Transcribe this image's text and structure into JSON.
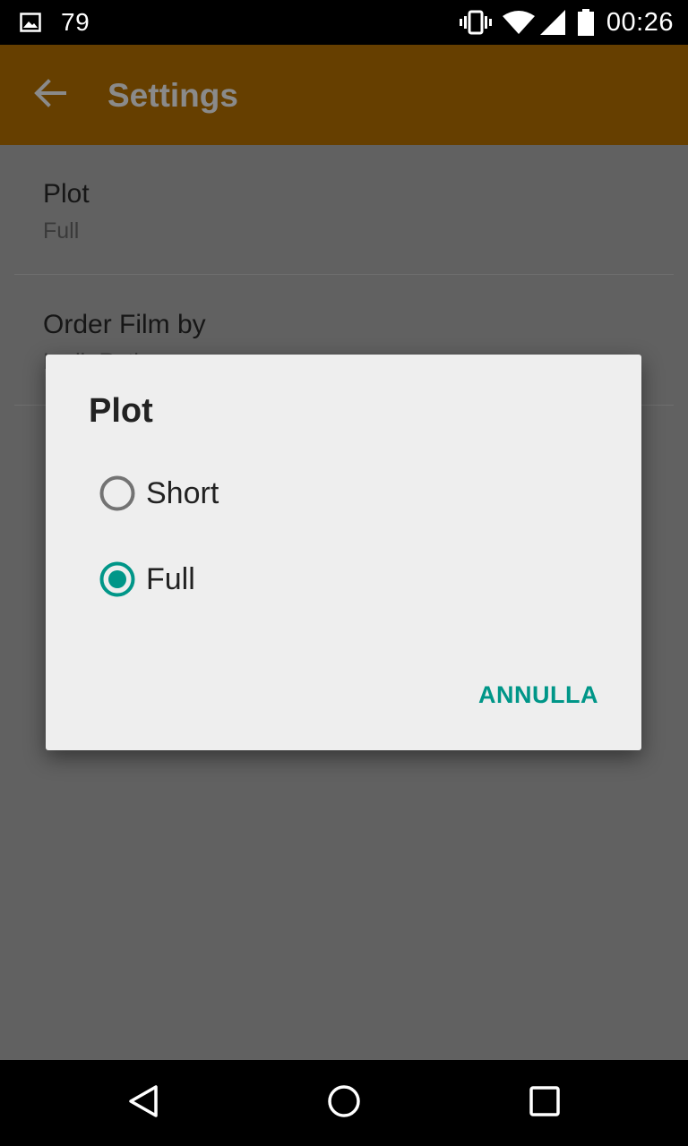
{
  "status_bar": {
    "notification_count": "79",
    "time": "00:26",
    "icons": [
      "image-notification-icon",
      "vibrate-icon",
      "wifi-icon",
      "cell-signal-icon",
      "battery-icon"
    ]
  },
  "app_bar": {
    "title": "Settings",
    "back_icon": "arrow-back-icon",
    "color": "#663f00"
  },
  "preferences": [
    {
      "title": "Plot",
      "summary": "Full"
    },
    {
      "title": "Order Film by",
      "summary": "Imdb Rating"
    }
  ],
  "dialog": {
    "title": "Plot",
    "options": [
      {
        "label": "Short",
        "selected": false
      },
      {
        "label": "Full",
        "selected": true
      }
    ],
    "cancel_label": "ANNULLA",
    "accent_color": "#009688"
  },
  "nav_bar": {
    "icons": [
      "back-triangle-icon",
      "home-circle-icon",
      "recents-square-icon"
    ]
  }
}
